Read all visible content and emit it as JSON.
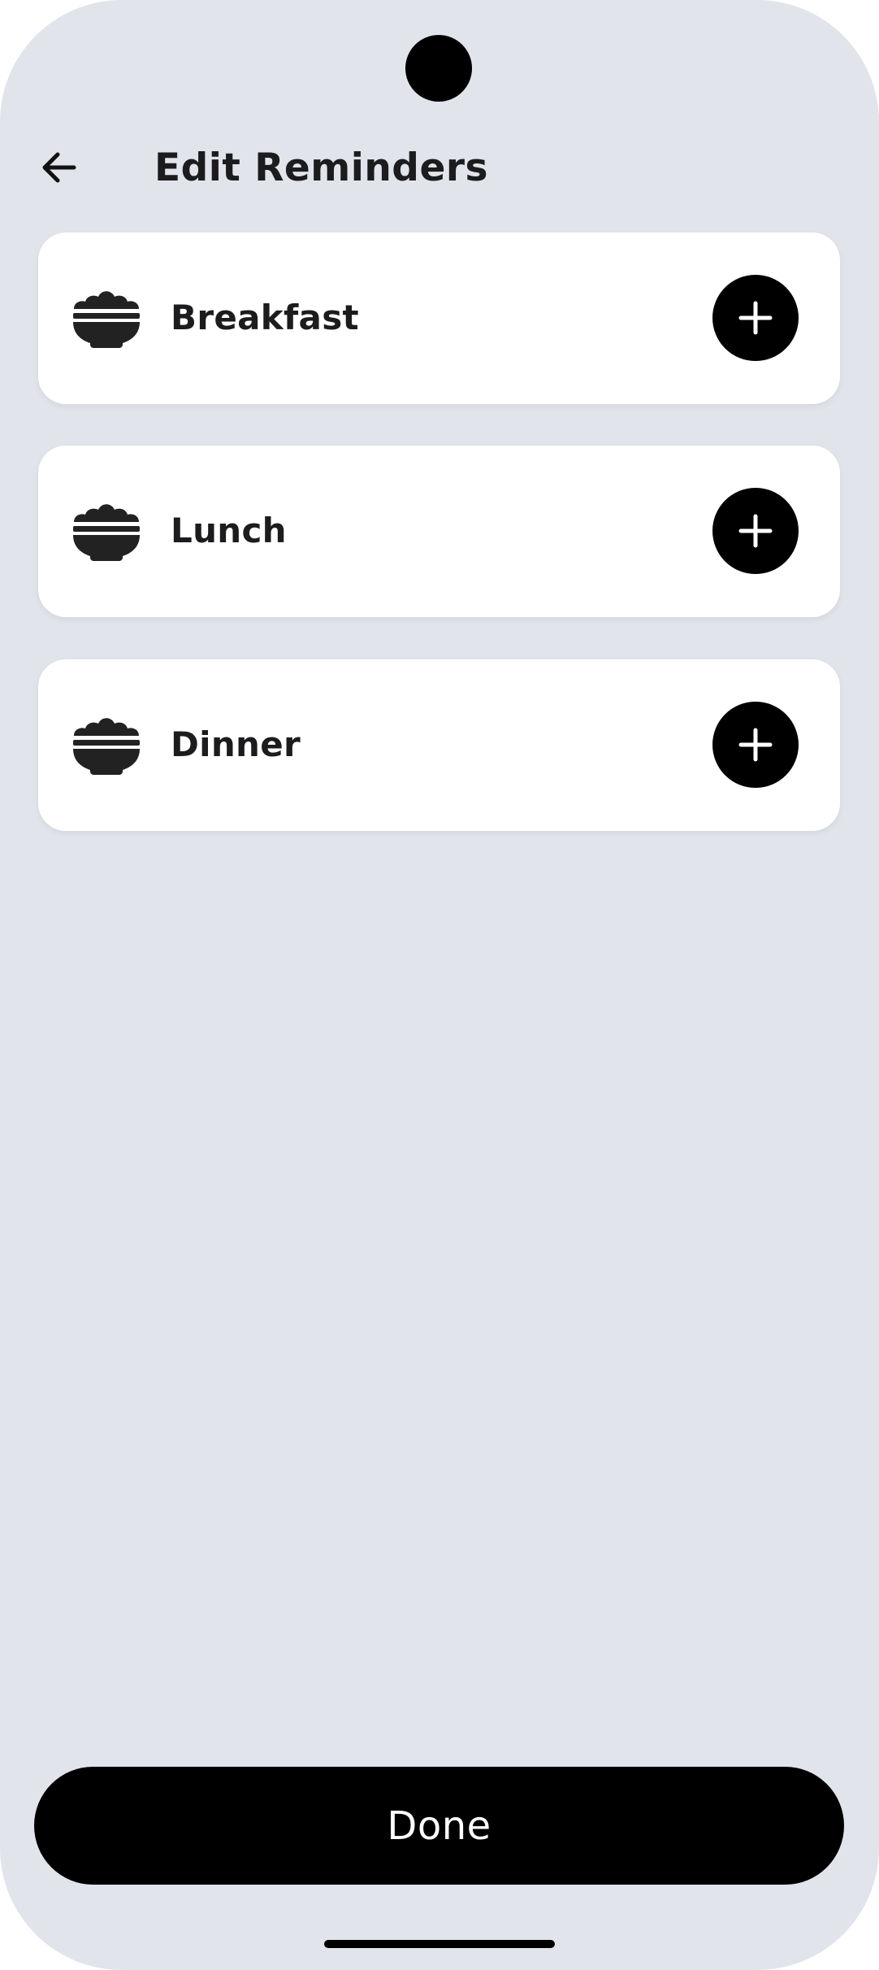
{
  "header": {
    "title": "Edit Reminders",
    "back_icon": "arrow-left-icon"
  },
  "meals": [
    {
      "label": "Breakfast",
      "icon": "rice-bowl-icon",
      "action_icon": "plus-icon"
    },
    {
      "label": "Lunch",
      "icon": "rice-bowl-icon",
      "action_icon": "plus-icon"
    },
    {
      "label": "Dinner",
      "icon": "rice-bowl-icon",
      "action_icon": "plus-icon"
    }
  ],
  "footer": {
    "done_label": "Done"
  },
  "colors": {
    "background": "#e1e4eb",
    "card": "#ffffff",
    "primary": "#000000",
    "text": "#1c1c1e"
  }
}
